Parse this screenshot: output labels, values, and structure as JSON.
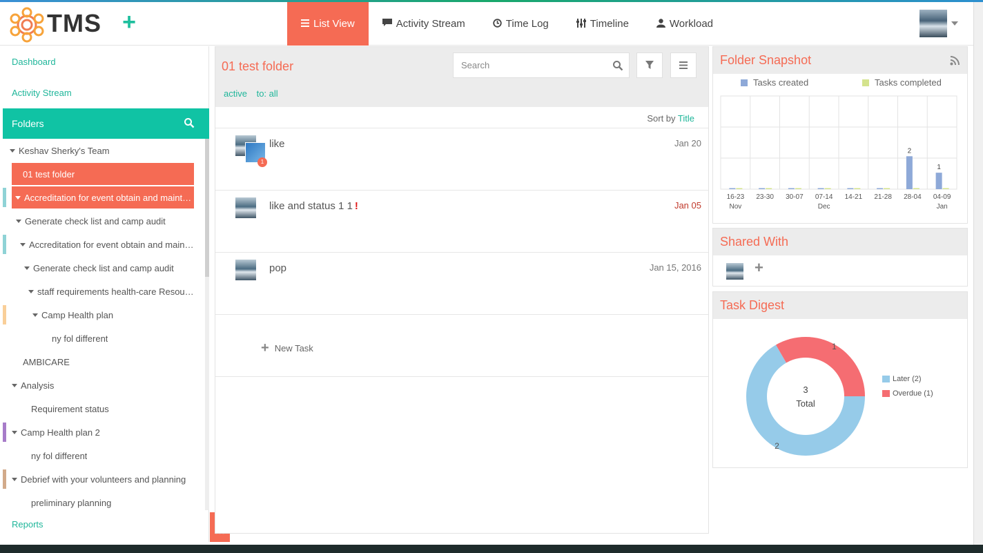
{
  "app": {
    "name": "TMS"
  },
  "nav": {
    "items": [
      {
        "label": "List View",
        "icon": "list-icon",
        "active": true
      },
      {
        "label": "Activity Stream",
        "icon": "comment-icon",
        "active": false
      },
      {
        "label": "Time Log",
        "icon": "clock-icon",
        "active": false
      },
      {
        "label": "Timeline",
        "icon": "sliders-icon",
        "active": false
      },
      {
        "label": "Workload",
        "icon": "user-icon",
        "active": false
      }
    ]
  },
  "sidebar": {
    "dashboard": "Dashboard",
    "activity_stream": "Activity Stream",
    "folders": "Folders",
    "reports": "Reports",
    "tree": [
      {
        "label": "Keshav Sherky's Team",
        "indent": 0,
        "caret": true,
        "selected": false,
        "mark": ""
      },
      {
        "label": "01 test folder",
        "indent": 1,
        "caret": false,
        "selected": true,
        "mark": ""
      },
      {
        "label": "Accreditation for event obtain and maintain",
        "indent": 1,
        "caret": true,
        "selected": true,
        "mark": "#8fd3d6"
      },
      {
        "label": "Generate check list and camp audit",
        "indent": 2,
        "caret": true,
        "selected": false,
        "mark": ""
      },
      {
        "label": "Accreditation for event obtain and maintain",
        "indent": 3,
        "caret": true,
        "selected": false,
        "mark": "#8fd3d6"
      },
      {
        "label": "Generate check list and camp audit",
        "indent": 4,
        "caret": true,
        "selected": false,
        "mark": ""
      },
      {
        "label": "staff requirements health-care Resources",
        "indent": 5,
        "caret": true,
        "selected": false,
        "mark": ""
      },
      {
        "label": "Camp Health plan",
        "indent": 6,
        "caret": true,
        "selected": false,
        "mark": "#f9cf99"
      },
      {
        "label": "ny fol different",
        "indent": 7,
        "caret": false,
        "selected": false,
        "mark": ""
      },
      {
        "label": "AMBICARE",
        "indent": 1,
        "caret": false,
        "selected": false,
        "mark": ""
      },
      {
        "label": "Analysis",
        "indent": 1,
        "caret": true,
        "selected": false,
        "mark": ""
      },
      {
        "label": "Requirement status",
        "indent": 2,
        "caret": false,
        "selected": false,
        "mark": ""
      },
      {
        "label": "Camp Health plan 2",
        "indent": 1,
        "caret": true,
        "selected": false,
        "mark": "#a77cc9"
      },
      {
        "label": "ny fol different",
        "indent": 2,
        "caret": false,
        "selected": false,
        "mark": ""
      },
      {
        "label": "Debrief with your volunteers and planning",
        "indent": 1,
        "caret": true,
        "selected": false,
        "mark": "#d2aa8a"
      },
      {
        "label": "preliminary planning",
        "indent": 2,
        "caret": false,
        "selected": false,
        "mark": ""
      }
    ]
  },
  "main": {
    "folder_title": "01 test folder",
    "search_placeholder": "Search",
    "filters": {
      "status": "active",
      "to": "to: all"
    },
    "sort": {
      "prefix": "Sort by",
      "value": "Title"
    },
    "tasks": [
      {
        "name": "like",
        "date": "Jan 20",
        "overdue": false,
        "flag": "",
        "badge": "1"
      },
      {
        "name": "like and status 1 1",
        "date": "Jan 05",
        "overdue": true,
        "flag": "!",
        "badge": ""
      },
      {
        "name": "pop",
        "date": "Jan 15, 2016",
        "overdue": false,
        "flag": "",
        "badge": ""
      }
    ],
    "new_task": "New Task"
  },
  "snapshot": {
    "title": "Folder Snapshot",
    "legend": [
      {
        "label": "Tasks created",
        "color": "#8ea9d8"
      },
      {
        "label": "Tasks completed",
        "color": "#d4e38d"
      }
    ]
  },
  "chart_data": [
    {
      "type": "bar",
      "title": "Folder Snapshot",
      "categories": [
        "16-23",
        "23-30",
        "30-07",
        "07-14",
        "14-21",
        "21-28",
        "28-04",
        "04-09"
      ],
      "month_labels": [
        "Nov",
        "",
        "",
        "Dec",
        "",
        "",
        "",
        "Jan"
      ],
      "series": [
        {
          "name": "Tasks created",
          "values": [
            0,
            0,
            0,
            0,
            0,
            0,
            2,
            1
          ]
        },
        {
          "name": "Tasks completed",
          "values": [
            0,
            0,
            0,
            0,
            0,
            0,
            0,
            0
          ]
        }
      ],
      "ylim": [
        0,
        3
      ],
      "grid": true,
      "legend": "top"
    },
    {
      "type": "pie",
      "title": "Task Digest",
      "center_value": "3",
      "center_label": "Total",
      "slices": [
        {
          "name": "Later (2)",
          "value": 2,
          "color": "#96cbe9"
        },
        {
          "name": "Overdue (1)",
          "value": 1,
          "color": "#f56d72"
        }
      ],
      "legend": "right"
    }
  ],
  "shared": {
    "title": "Shared With"
  },
  "digest": {
    "title": "Task Digest"
  }
}
